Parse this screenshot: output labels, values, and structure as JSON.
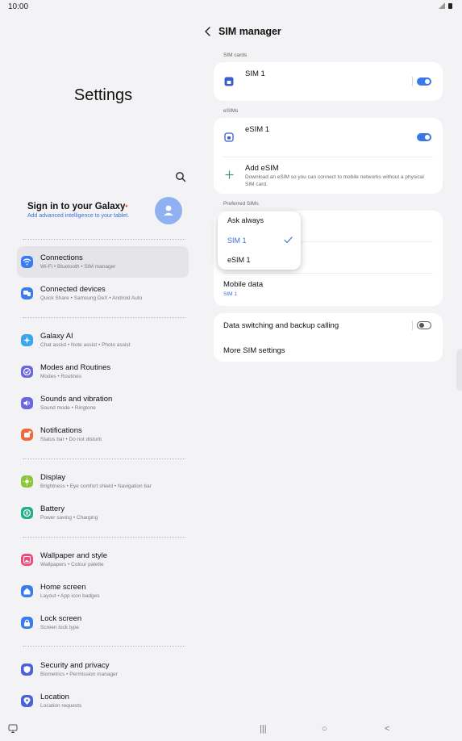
{
  "status": {
    "time": "10:00",
    "icons": "signal-icon battery-icon"
  },
  "left": {
    "title": "Settings",
    "account": {
      "title": "Sign in to your Galaxy",
      "dot": "•",
      "subtitle": "Add advanced intelligence to your tablet."
    },
    "menu": [
      {
        "title": "Connections",
        "sub": "Wi-Fi • Bluetooth • SIM manager",
        "color": "#3a7bef",
        "icon": "wifi-icon"
      },
      {
        "title": "Connected devices",
        "sub": "Quick Share • Samsung DeX • Android Auto",
        "color": "#3a7bef",
        "icon": "devices-icon"
      },
      {
        "title": "Galaxy AI",
        "sub": "Chat assist • Note assist • Photo assist",
        "color": "#3aa6ee",
        "icon": "sparkle-icon"
      },
      {
        "title": "Modes and Routines",
        "sub": "Modes • Routines",
        "color": "#6a67e0",
        "icon": "check-circle-icon"
      },
      {
        "title": "Sounds and vibration",
        "sub": "Sound mode • Ringtone",
        "color": "#6a67e0",
        "icon": "speaker-icon"
      },
      {
        "title": "Notifications",
        "sub": "Status bar • Do not disturb",
        "color": "#ee6a3a",
        "icon": "bell-icon"
      },
      {
        "title": "Display",
        "sub": "Brightness • Eye comfort shield • Navigation bar",
        "color": "#8cc43a",
        "icon": "sun-icon"
      },
      {
        "title": "Battery",
        "sub": "Power saving • Charging",
        "color": "#25ad8a",
        "icon": "battery-ring-icon"
      },
      {
        "title": "Wallpaper and style",
        "sub": "Wallpapers • Colour palette",
        "color": "#ee4a7a",
        "icon": "image-icon"
      },
      {
        "title": "Home screen",
        "sub": "Layout • App icon badges",
        "color": "#3a7bef",
        "icon": "home-icon"
      },
      {
        "title": "Lock screen",
        "sub": "Screen lock type",
        "color": "#3a7bef",
        "icon": "lock-icon"
      },
      {
        "title": "Security and privacy",
        "sub": "Biometrics • Permission manager",
        "color": "#4a62d8",
        "icon": "shield-icon"
      },
      {
        "title": "Location",
        "sub": "Location requests",
        "color": "#4a62d8",
        "icon": "pin-icon"
      }
    ]
  },
  "right": {
    "title": "SIM manager",
    "sim_cards_label": "SIM cards",
    "sim1": "SIM 1",
    "esims_label": "eSIMs",
    "esim1": "eSIM 1",
    "add_esim": {
      "title": "Add eSIM",
      "sub": "Download an eSIM so you can connect to mobile networks without a physical SIM card."
    },
    "preferred_label": "Preferred SIMs",
    "mobile_data": {
      "title": "Mobile data",
      "value": "SIM 1"
    },
    "data_switching": "Data switching and backup calling",
    "more_settings": "More SIM settings",
    "accent": "#3a78e7"
  },
  "dropdown": {
    "options": [
      "Ask always",
      "SIM 1",
      "eSIM 1"
    ],
    "selected": "SIM 1"
  },
  "nav": {
    "recents": "|||",
    "home": "○",
    "back": "<"
  }
}
